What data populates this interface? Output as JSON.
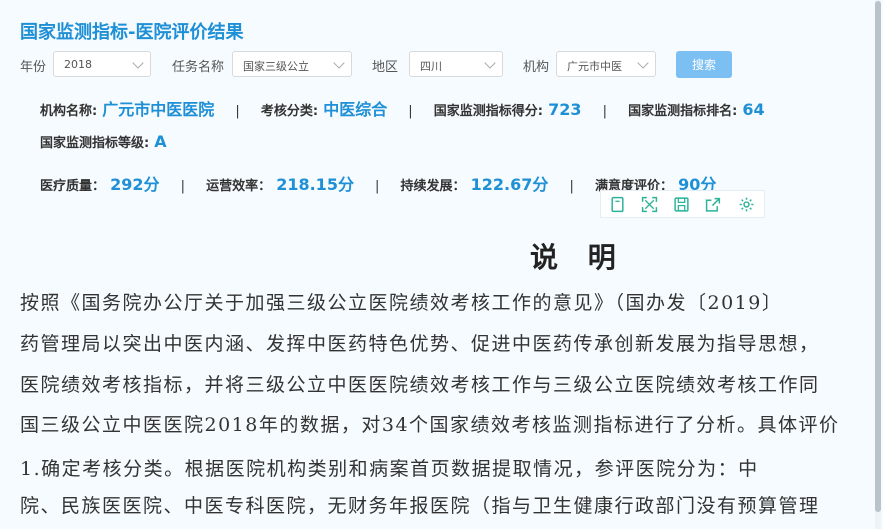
{
  "header": {
    "title": "国家监测指标-医院评价结果"
  },
  "filters": {
    "year": {
      "label": "年份",
      "value": "2018"
    },
    "task": {
      "label": "任务名称",
      "value": "国家三级公立"
    },
    "region": {
      "label": "地区",
      "value": "四川"
    },
    "institution": {
      "label": "机构",
      "value": "广元市中医"
    },
    "search_label": "搜索"
  },
  "summary": {
    "name_key": "机构名称:",
    "name_val": "广元市中医医院",
    "category_key": "考核分类:",
    "category_val": "中医综合",
    "score_key": "国家监测指标得分:",
    "score_val": "723",
    "rank_key": "国家监测指标排名:",
    "rank_val": "64",
    "grade_key": "国家监测指标等级:",
    "grade_val": "A",
    "sep": "|"
  },
  "scores": {
    "medical_key": "医疗质量：",
    "medical_val": "292分",
    "efficiency_key": "运营效率：",
    "efficiency_val": "218.15分",
    "sustain_key": "持续发展：",
    "sustain_val": "122.67分",
    "satisfaction_key": "满意度评价：",
    "satisfaction_val": "90分"
  },
  "toolbar": {
    "icons": [
      "copy-icon",
      "fullscreen-icon",
      "save-icon",
      "export-icon",
      "settings-icon"
    ]
  },
  "doc": {
    "title": "说 明",
    "lines": [
      "    按照《国务院办公厅关于加强三级公立医院绩效考核工作的意见》（国办发〔2019〕",
      "药管理局以突出中医内涵、发挥中医药特色优势、促进中医药传承创新发展为指导思想，",
      "医院绩效考核指标，并将三级公立中医医院绩效考核工作与三级公立医院绩效考核工作同",
      "国三级公立中医医院2018年的数据，对34个国家绩效考核监测指标进行了分析。具体评价",
      "    1.确定考核分类。根据医院机构类别和病案首页数据提取情况，参评医院分为：中",
      "院、民族医医院、中医专科医院，无财务年报医院（指与卫生健康行政部门没有预算管理"
    ]
  },
  "colors": {
    "accent": "#1f8fd6",
    "button": "#7cc0f3",
    "background": "#f5fbfe"
  }
}
